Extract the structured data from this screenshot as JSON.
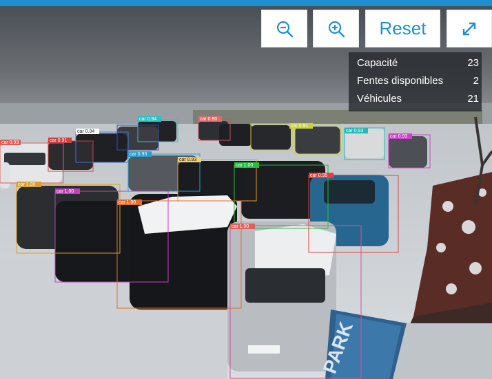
{
  "toolbar": {
    "zoom_out_icon": "zoom-out-icon",
    "zoom_in_icon": "zoom-in-icon",
    "reset_label": "Reset",
    "expand_icon": "expand-icon"
  },
  "stats": {
    "rows": [
      {
        "label": "Capacité",
        "value": "23"
      },
      {
        "label": "Fentes disponibles",
        "value": "2"
      },
      {
        "label": "Véhicules",
        "value": "21"
      }
    ]
  },
  "detections": {
    "labels": [
      "car 0.93",
      "car 0.91",
      "car 0.94",
      "car 0.94",
      "car 0.90",
      "car 0.91",
      "car 0.93",
      "car 0.93",
      "car 0.93",
      "car 0.93",
      "car 1.00",
      "car 0.95",
      "car 1.00",
      "car 1.00",
      "car 1.00",
      "car 1.00"
    ]
  },
  "signage": {
    "parking_sign": "PARK"
  },
  "colors": {
    "accent": "#1e8fd4",
    "panel_bg": "#26282c"
  }
}
